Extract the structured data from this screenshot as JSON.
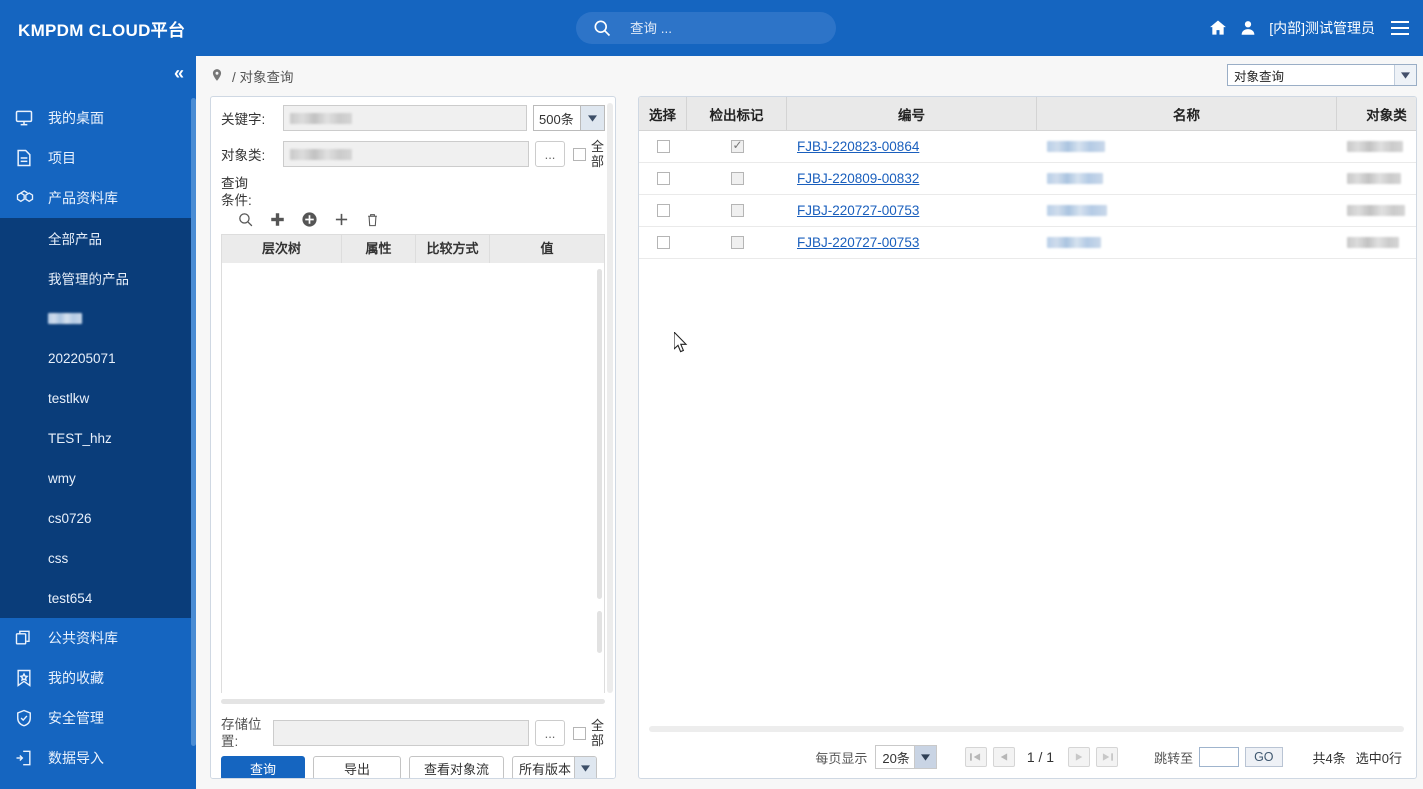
{
  "header": {
    "brand": "KMPDM CLOUD平台",
    "search_placeholder": "查询 ...",
    "search_value": "",
    "user": "[内部]测试管理员",
    "icons": {
      "home": "home-icon",
      "user": "user-icon",
      "menu": "hamburger-icon",
      "search": "search-icon"
    }
  },
  "sidebar": {
    "collapse": "«",
    "items": [
      {
        "label": "我的桌面",
        "icon": "monitor-icon"
      },
      {
        "label": "项目",
        "icon": "document-icon"
      },
      {
        "label": "产品资料库",
        "icon": "cube-icon",
        "active": true
      }
    ],
    "sub_items": [
      {
        "label": "全部产品"
      },
      {
        "label": "我管理的产品"
      },
      {
        "label": "",
        "redacted": true
      },
      {
        "label": "202205071"
      },
      {
        "label": "testlkw"
      },
      {
        "label": "TEST_hhz"
      },
      {
        "label": "wmy"
      },
      {
        "label": "cs0726"
      },
      {
        "label": "css"
      },
      {
        "label": "test654"
      }
    ],
    "items_after": [
      {
        "label": "公共资料库",
        "icon": "copy-icon"
      },
      {
        "label": "我的收藏",
        "icon": "bookmark-star-icon"
      },
      {
        "label": "安全管理",
        "icon": "shield-check-icon"
      },
      {
        "label": "数据导入",
        "icon": "import-icon"
      }
    ]
  },
  "breadcrumb": {
    "icon": "location-pin-icon",
    "text": "/ 对象查询"
  },
  "view_select": {
    "value": "对象查询",
    "arrow": "chevron-down-icon"
  },
  "query_panel": {
    "keyword_label": "关键字:",
    "keyword_value": "",
    "count_select": "500条",
    "objclass_label": "对象类:",
    "objclass_value": "",
    "dots_button": "...",
    "all_label": "全部",
    "all_checked": false,
    "condition_label": "查询条件:",
    "cond_icons": [
      "search-icon",
      "plus-square-icon",
      "plus-circle-icon",
      "plus-icon",
      "trash-icon"
    ],
    "cond_columns": [
      "层次树",
      "属性",
      "比较方式",
      "值"
    ],
    "cond_rows": [],
    "storage_label": "存储位置:",
    "storage_value": "",
    "storage_all_label": "全部",
    "storage_all_checked": false,
    "buttons": {
      "query": "查询",
      "export": "导出",
      "view_flow": "查看对象流",
      "version": "所有版本"
    }
  },
  "results": {
    "columns": [
      "选择",
      "检出标记",
      "编号",
      "名称",
      "对象类"
    ],
    "rows": [
      {
        "select": false,
        "checked_out": true,
        "number": "FJBJ-220823-00864",
        "name": "",
        "objclass": ""
      },
      {
        "select": false,
        "checked_out": false,
        "number": "FJBJ-220809-00832",
        "name": "",
        "objclass": ""
      },
      {
        "select": false,
        "checked_out": false,
        "number": "FJBJ-220727-00753",
        "name": "",
        "objclass": ""
      },
      {
        "select": false,
        "checked_out": false,
        "number": "FJBJ-220727-00753",
        "name": "",
        "objclass": ""
      }
    ],
    "pager": {
      "per_page_label": "每页显示",
      "per_page_value": "20条",
      "page_indicator": "1 / 1",
      "jump_label": "跳转至",
      "jump_value": "",
      "go_label": "GO",
      "total": "共4条",
      "selected": "选中0行",
      "first": "first-page-icon",
      "prev": "prev-page-icon",
      "next": "next-page-icon",
      "last": "last-page-icon"
    }
  },
  "colors": {
    "brand_blue": "#1565c0",
    "submenu_blue": "#0a3d7a",
    "link_blue": "#1a5fbd",
    "panel_border": "#cfd8e3",
    "header_gray": "#e9e9e9"
  }
}
